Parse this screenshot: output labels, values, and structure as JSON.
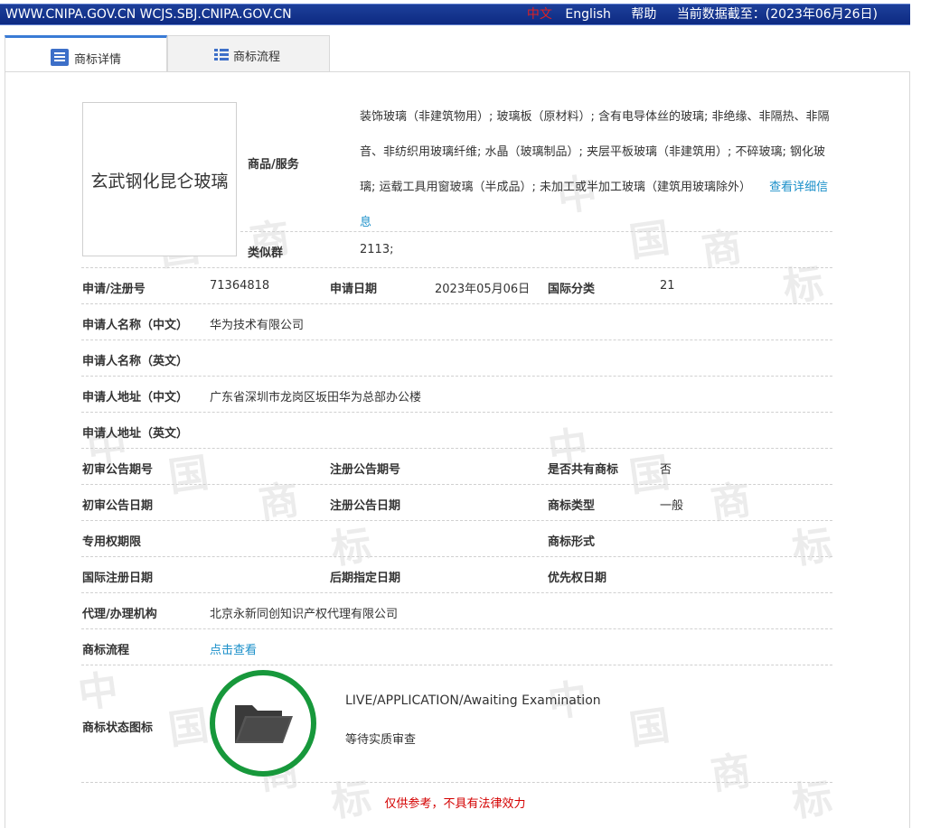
{
  "topbar": {
    "urls": "WWW.CNIPA.GOV.CN WCJS.SBJ.CNIPA.GOV.CN",
    "lang_zh": "中文",
    "lang_en": "English",
    "help": "帮助",
    "data_date": "当前数据截至：(2023年06月26日)"
  },
  "tabs": [
    {
      "label": "商标详情",
      "icon": "document-icon",
      "active": true
    },
    {
      "label": "商标流程",
      "icon": "list-icon",
      "active": false
    }
  ],
  "mark": {
    "text": "玄武钢化昆仑玻璃",
    "goods_label": "商品/服务",
    "goods_text": "装饰玻璃（非建筑物用）; 玻璃板（原材料）; 含有电导体丝的玻璃; 非绝缘、非隔热、非隔音、非纺织用玻璃纤维; 水晶（玻璃制品）; 夹层平板玻璃（非建筑用）; 不碎玻璃; 钢化玻璃; 运载工具用窗玻璃（半成品）; 未加工或半加工玻璃（建筑用玻璃除外）",
    "goods_link": "查看详细信息",
    "group_label": "类似群",
    "group_value": "2113;"
  },
  "fields": {
    "reg_no_label": "申请/注册号",
    "reg_no": "71364818",
    "app_date_label": "申请日期",
    "app_date": "2023年05月06日",
    "intl_class_label": "国际分类",
    "intl_class": "21",
    "applicant_cn_label": "申请人名称（中文）",
    "applicant_cn": "华为技术有限公司",
    "applicant_en_label": "申请人名称（英文）",
    "applicant_en": "",
    "address_cn_label": "申请人地址（中文）",
    "address_cn": "广东省深圳市龙岗区坂田华为总部办公楼",
    "address_en_label": "申请人地址（英文）",
    "address_en": "",
    "prelim_no_label": "初审公告期号",
    "prelim_no": "",
    "reg_pub_no_label": "注册公告期号",
    "reg_pub_no": "",
    "shared_label": "是否共有商标",
    "shared": "否",
    "prelim_date_label": "初审公告日期",
    "prelim_date": "",
    "reg_pub_date_label": "注册公告日期",
    "reg_pub_date": "",
    "mark_type_label": "商标类型",
    "mark_type": "一般",
    "exclusive_label": "专用权期限",
    "exclusive": "",
    "mark_form_label": "商标形式",
    "mark_form": "",
    "intl_reg_date_label": "国际注册日期",
    "intl_reg_date": "",
    "later_date_label": "后期指定日期",
    "later_date": "",
    "priority_label": "优先权日期",
    "priority": "",
    "agent_label": "代理/办理机构",
    "agent": "北京永新同创知识产权代理有限公司",
    "process_label": "商标流程",
    "process_link": "点击查看",
    "status_icon_label": "商标状态图标",
    "status_en": "LIVE/APPLICATION/Awaiting Examination",
    "status_cn": "等待实质审查"
  },
  "disclaimer": "仅供参考，不具有法律效力",
  "colors": {
    "topbar": "#0d2a82",
    "link": "#1a8fc9",
    "status_ring": "#17983b",
    "disclaimer": "#d40000",
    "tab_accent": "#3a7bd5"
  },
  "status_icon": "folder-icon"
}
